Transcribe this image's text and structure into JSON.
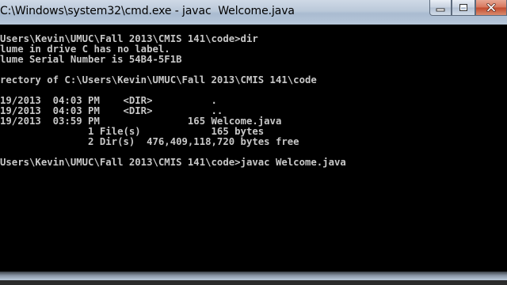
{
  "window": {
    "title": "C:\\Windows\\system32\\cmd.exe - javac  Welcome.java",
    "minimize_icon": "minimize-icon",
    "maximize_icon": "maximize-icon",
    "close_icon": "close-icon"
  },
  "console": {
    "lines": [
      "Users\\Kevin\\UMUC\\Fall 2013\\CMIS 141\\code>dir",
      "lume in drive C has no label.",
      "lume Serial Number is 54B4-5F1B",
      "",
      "rectory of C:\\Users\\Kevin\\UMUC\\Fall 2013\\CMIS 141\\code",
      "",
      "19/2013  04:03 PM    <DIR>          .",
      "19/2013  04:03 PM    <DIR>          ..",
      "19/2013  03:59 PM               165 Welcome.java",
      "               1 File(s)            165 bytes",
      "               2 Dir(s)  476,409,118,720 bytes free",
      "",
      "Users\\Kevin\\UMUC\\Fall 2013\\CMIS 141\\code>javac Welcome.java"
    ]
  }
}
